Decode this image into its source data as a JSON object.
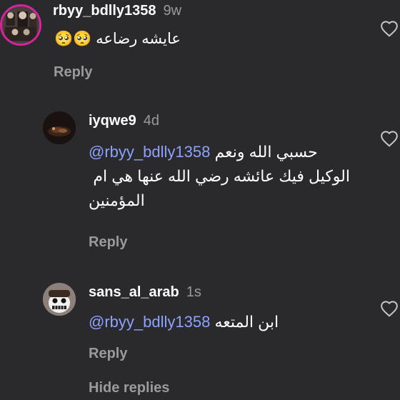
{
  "comments": [
    {
      "username": "rbyy_bdlly1358",
      "time": "9w",
      "text": "عايشه رضاعه 🥺🥺",
      "reply_label": "Reply"
    },
    {
      "username": "iyqwe9",
      "time": "4d",
      "mention": "@rbyy_bdlly1358",
      "line1": "حسبي الله ونعم",
      "line2": "الوكيل فيك عائشه رضي الله عنها هي ام",
      "line3": "المؤمنين",
      "reply_label": "Reply"
    },
    {
      "username": "sans_al_arab",
      "time": "1s",
      "mention": "@rbyy_bdlly1358",
      "line1": "ابن المتعه",
      "reply_label": "Reply"
    }
  ],
  "hide_replies_label": "Hide replies",
  "icons": {
    "like": "heart-outline-icon"
  },
  "colors": {
    "background": "#2a2a2c",
    "mention": "#8da2ff",
    "muted": "#9a9a9c",
    "story_ring": "#e1306c"
  }
}
